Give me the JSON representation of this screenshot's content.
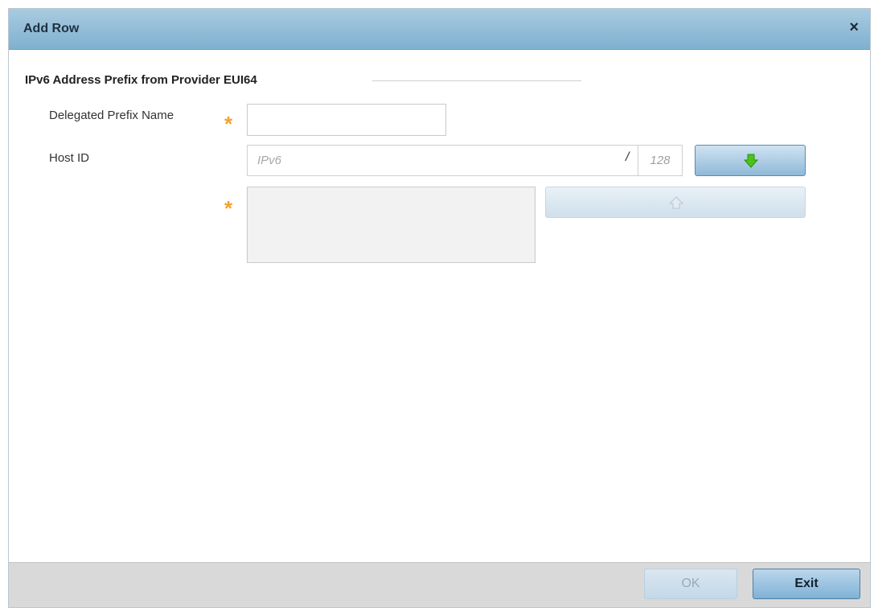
{
  "dialog": {
    "title": "Add Row",
    "close_glyph": "×"
  },
  "section": {
    "title": "IPv6 Address Prefix from Provider EUI64"
  },
  "fields": {
    "delegated_prefix_name": {
      "label": "Delegated Prefix Name",
      "value": "",
      "required": true
    },
    "host_id": {
      "label": "Host ID",
      "placeholder": "IPv6",
      "separator": "/",
      "prefix_length": "128"
    },
    "host_list": {
      "required": true,
      "items": []
    }
  },
  "required_marker": "*",
  "icons": {
    "add": "arrow-down-icon",
    "remove": "arrow-up-icon",
    "close": "close-icon"
  },
  "colors": {
    "titlebar": "#8fbad7",
    "required": "#f5a12a",
    "add_arrow": "#4cc21c",
    "footer": "#d9d9d9"
  },
  "footer": {
    "ok_label": "OK",
    "ok_enabled": false,
    "exit_label": "Exit"
  }
}
